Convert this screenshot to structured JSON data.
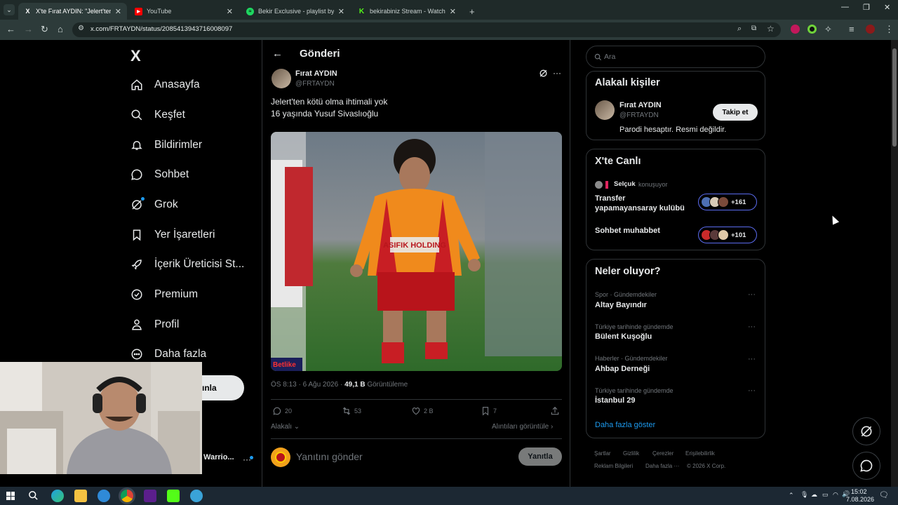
{
  "browser": {
    "tabs": [
      {
        "title": "X'te Fırat AYDIN: \"Jelert'ten kötü",
        "icon": "x-logo-icon",
        "active": true
      },
      {
        "title": "YouTube",
        "icon": "youtube-icon",
        "active": false
      },
      {
        "title": "Bekir Exclusive - playlist by Bekir",
        "icon": "spotify-icon",
        "active": false
      },
      {
        "title": "bekirabiniz Stream - Watch Live",
        "icon": "kick-icon",
        "active": false
      }
    ],
    "new_tab": "+",
    "url": "x.com/FRTAYDN/status/2085413943716008097"
  },
  "sidebar": {
    "logo": "X",
    "items": [
      {
        "label": "Anasayfa",
        "icon": "home-icon"
      },
      {
        "label": "Keşfet",
        "icon": "search-icon"
      },
      {
        "label": "Bildirimler",
        "icon": "bell-icon"
      },
      {
        "label": "Sohbet",
        "icon": "chat-icon"
      },
      {
        "label": "Grok",
        "icon": "grok-icon"
      },
      {
        "label": "Yer İşaretleri",
        "icon": "bookmark-icon"
      },
      {
        "label": "İçerik Üreticisi St...",
        "icon": "rocket-icon"
      },
      {
        "label": "Premium",
        "icon": "verified-icon"
      },
      {
        "label": "Profil",
        "icon": "profile-icon"
      },
      {
        "label": "Daha fazla",
        "icon": "more-icon"
      }
    ],
    "post_button": "ınla",
    "account_name": "Warrio..."
  },
  "post": {
    "header": "Gönderi",
    "author_name": "Fırat AYDIN",
    "author_handle": "@FRTAYDN",
    "text_line1": "Jelert'ten kötü olma ihtimali yok",
    "text_line2": "16 yaşında Yusuf Sivaslıoğlu",
    "image_sponsor": "ASIFIK HOLDING",
    "image_watermark": "Betlike",
    "time": "ÖS 8:13 · 6 Ağu 2026 ·",
    "views": "49,1 B",
    "views_label": "Görüntüleme",
    "replies": "20",
    "reposts": "53",
    "likes": "2 B",
    "bookmarks": "7",
    "related_link": "Alakalı",
    "quotes_link": "Alıntıları görüntüle",
    "reply_placeholder": "Yanıtını gönder",
    "reply_button": "Yanıtla"
  },
  "search": {
    "placeholder": "Ara"
  },
  "related_people": {
    "title": "Alakalı kişiler",
    "name": "Fırat AYDIN",
    "handle": "@FRTAYDN",
    "bio": "Parodi hesaptır. Resmi değildir.",
    "follow_button": "Takip et"
  },
  "live": {
    "title": "X'te Canlı",
    "host": "Selçuk",
    "host_status": "konuşuyor",
    "spaces": [
      {
        "title_line1": "Transfer",
        "title_line2": "yapamayansaray kulübü",
        "count": "+161"
      },
      {
        "title_line1": "Sohbet muhabbet",
        "title_line2": "",
        "count": "+101"
      }
    ]
  },
  "trends": {
    "title": "Neler oluyor?",
    "items": [
      {
        "context": "Spor · Gündemdekiler",
        "name": "Altay Bayındır"
      },
      {
        "context": "Türkiye tarihinde gündemde",
        "name": "Bülent Kuşoğlu"
      },
      {
        "context": "Haberler · Gündemdekiler",
        "name": "Ahbap Derneği"
      },
      {
        "context": "Türkiye tarihinde gündemde",
        "name": "İstanbul 29"
      }
    ],
    "show_more": "Daha fazla göster"
  },
  "footer": {
    "row1": [
      "Şartlar",
      "Gizlilik",
      "Çerezler",
      "Erişilebilirlik"
    ],
    "row2": [
      "Reklam Bilgileri",
      "Daha fazla ···",
      "© 2026 X Corp."
    ]
  },
  "taskbar": {
    "time": "15:02",
    "date": "7.08.2026"
  },
  "colors": {
    "accent": "#1d9bf0",
    "background": "#000000",
    "chrome": "#2d3b3a"
  }
}
